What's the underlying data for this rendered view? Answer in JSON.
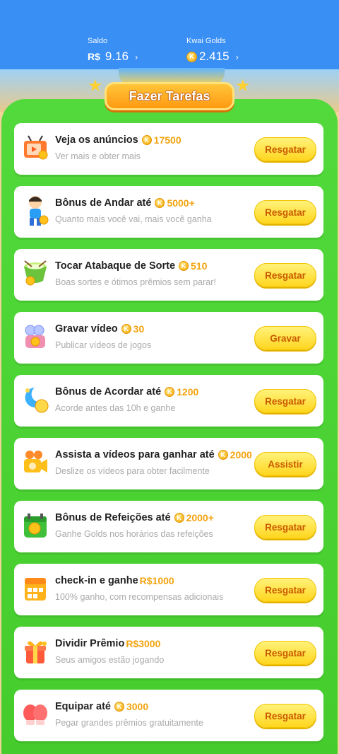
{
  "header": {
    "saldo_label": "Saldo",
    "saldo_currency": "R$",
    "saldo_value": "9.16",
    "golds_label": "Kwai Golds",
    "golds_value": "2.415",
    "chevron": "›"
  },
  "banner": {
    "title": "Fazer Tarefas"
  },
  "coin_letter": "K",
  "colors": {
    "panel_green": "#4fd638",
    "button_yellow": "#ffe04a",
    "reward_orange": "#f2a30f",
    "header_blue": "#3a8ff5"
  },
  "tasks": [
    {
      "icon": "tv-ads-icon",
      "title": "Veja os anúncios",
      "has_coin": true,
      "reward": "17500",
      "subtitle": "Ver mais e obter mais",
      "button": "Resgatar"
    },
    {
      "icon": "walking-boy-icon",
      "title": "Bônus de Andar até",
      "has_coin": true,
      "reward": "5000+",
      "subtitle": "Quanto mais você vai, mais você ganha",
      "button": "Resgatar"
    },
    {
      "icon": "drum-icon",
      "title": "Tocar Atabaque de Sorte",
      "has_coin": true,
      "reward": "510",
      "subtitle": "Boas sortes e ótimos prêmios sem parar!",
      "button": "Resgatar"
    },
    {
      "icon": "video-camera-icon",
      "title": "Gravar vídeo",
      "has_coin": true,
      "reward": "30",
      "subtitle": "Publicar vídeos de jogos",
      "button": "Gravar"
    },
    {
      "icon": "moon-alarm-icon",
      "title": "Bônus de Acordar até",
      "has_coin": true,
      "reward": "1200",
      "subtitle": "Acorde antes das 10h e ganhe",
      "button": "Resgatar"
    },
    {
      "icon": "movie-camera-icon",
      "title": "Assista a vídeos para ganhar até",
      "has_coin": true,
      "reward": "2000",
      "subtitle": "Deslize os vídeos para obter facilmente",
      "button": "Assistir"
    },
    {
      "icon": "meal-calendar-icon",
      "title": "Bônus de Refeições até",
      "has_coin": true,
      "reward": "2000+",
      "subtitle": "Ganhe Golds nos horários das refeições",
      "button": "Resgatar"
    },
    {
      "icon": "calendar-checkin-icon",
      "title": "check-in e ganhe",
      "has_coin": false,
      "reward": "R$1000",
      "subtitle": "100% ganho, com recompensas adicionais",
      "button": "Resgatar"
    },
    {
      "icon": "gift-box-icon",
      "title": "Dividir Prêmio",
      "has_coin": false,
      "reward": "R$3000",
      "subtitle": "Seus amigos estão jogando",
      "button": "Resgatar"
    },
    {
      "icon": "boxing-gloves-icon",
      "title": "Equipar até",
      "has_coin": true,
      "reward": "3000",
      "subtitle": "Pegar grandes prêmios gratuitamente",
      "button": "Resgatar"
    }
  ]
}
